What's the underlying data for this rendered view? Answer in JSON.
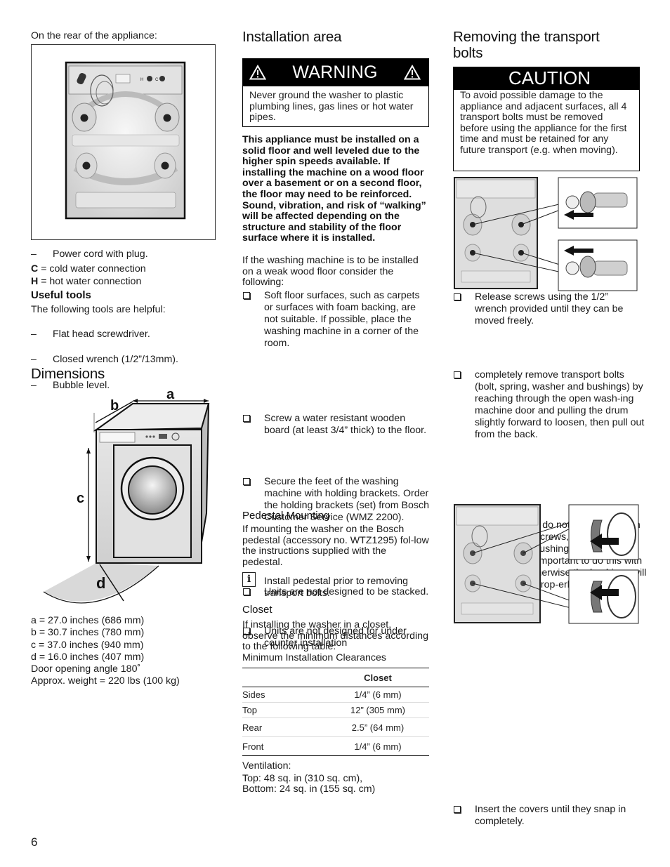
{
  "page_number": "6",
  "column1": {
    "rear_caption": "On the rear of the appliance:",
    "rear_figure": {
      "labels": {
        "hot": "H",
        "cold": "C"
      }
    },
    "rear_items": [
      {
        "bullet": "–",
        "text": "Power cord with plug."
      }
    ],
    "connections": [
      {
        "key": "C",
        "text": " = cold water connection"
      },
      {
        "key": "H",
        "text": " = hot water connection"
      }
    ],
    "useful_tools": {
      "heading": "Useful tools",
      "intro": "The following tools are helpful:",
      "items": [
        {
          "bullet": "–",
          "text": "Flat head screwdriver."
        },
        {
          "bullet": "–",
          "text": "Closed wrench (1/2”/13mm)."
        },
        {
          "bullet": "–",
          "text": "Bubble level."
        }
      ]
    },
    "dimensions": {
      "heading": "Dimensions",
      "figure_labels": {
        "a": "a",
        "b": "b",
        "c": "c",
        "d": "d"
      },
      "values": [
        "a = 27.0 inches (686 mm)",
        "b = 30.7 inches (780 mm)",
        "c = 37.0 inches (940 mm)",
        "d = 16.0 inches (407 mm)",
        "Door opening angle 180˚",
        "Approx. weight = 220 lbs (100 kg)"
      ]
    }
  },
  "column2": {
    "heading": "Installation area",
    "warning": {
      "title": "WARNING",
      "icon": "warning-triangle-icon",
      "text": "Never ground the washer to plastic plumbing lines, gas lines or hot water pipes."
    },
    "bold_paragraph": "This appliance must be installed on a solid floor and well leveled due to the higher spin speeds available. If installing the machine on a wood floor over a basement or on a second floor, the floor may need to be reinforced. Sound, vibration, and risk of “walking” will be affected depending on the structure and stability of the floor surface where it is installed.",
    "weak_floor_intro": "If the washing machine is to be installed on a weak wood floor consider the following:",
    "checklist": [
      "Soft floor surfaces, such as carpets or surfaces with foam backing, are not suitable. If possible, place the washing machine in a corner of the room.",
      "Screw a water resistant wooden board (at least 3/4” thick) to the floor.",
      "Secure the feet of the washing machine with holding brackets. Order the holding brackets (set) from Bosch Customer Service (WMZ 2200).",
      "Units are not designed to be stacked.",
      "Units are not designed for under counter installation"
    ],
    "pedestal": {
      "heading": "Pedestal Mounting",
      "text": "If mounting the washer on the Bosch pedestal (accessory no. WTZ1295) fol-low the instructions supplied with the pedestal.",
      "info_icon": "i",
      "info_text": "Install pedestal prior to removing transport bolts."
    },
    "closet": {
      "heading": "Closet",
      "text": "If installing the washer in a closet, observe the minimum distances according to the following table:",
      "table_caption": "Minimum Installation Clearances",
      "table": {
        "columns": [
          "",
          "Closet"
        ],
        "rows": [
          [
            "Sides",
            "1/4” (6 mm)"
          ],
          [
            "Top",
            "12” (305 mm)"
          ],
          [
            "Rear",
            "2.5” (64 mm)"
          ],
          [
            "Front",
            "1/4” (6 mm)"
          ]
        ]
      },
      "ventilation_label": "Ventilation:",
      "ventilation_top": "Top: 48 sq. in (310 sq. cm),",
      "ventilation_bottom": "Bottom: 24 sq. in (155 sq. cm)"
    }
  },
  "column3": {
    "heading_line1": "Removing the transport",
    "heading_line2": "bolts",
    "caution": {
      "title": "CAUTION",
      "text": "To avoid possible damage to the appliance and adjacent surfaces, all 4 transport bolts must be removed before using the appliance for the first time and must be retained for any future transport (e.g. when moving)."
    },
    "steps": [
      "Release screws using the 1/2” wrench provided until they can be moved freely.",
      "completely remove transport bolts (bolt, spring, washer and bushings) by reaching through the open wash-ing machine door and pulling the drum slightly forward to loosen, then pull out from the back.",
      "If the bushings do not come out when removing the screws, place screws back into the bushings and carefully try again.  It is important to do this with the screws, otherwise the bushings will not come out prop-erly."
    ],
    "final_step": "Insert the covers until they snap in completely."
  }
}
